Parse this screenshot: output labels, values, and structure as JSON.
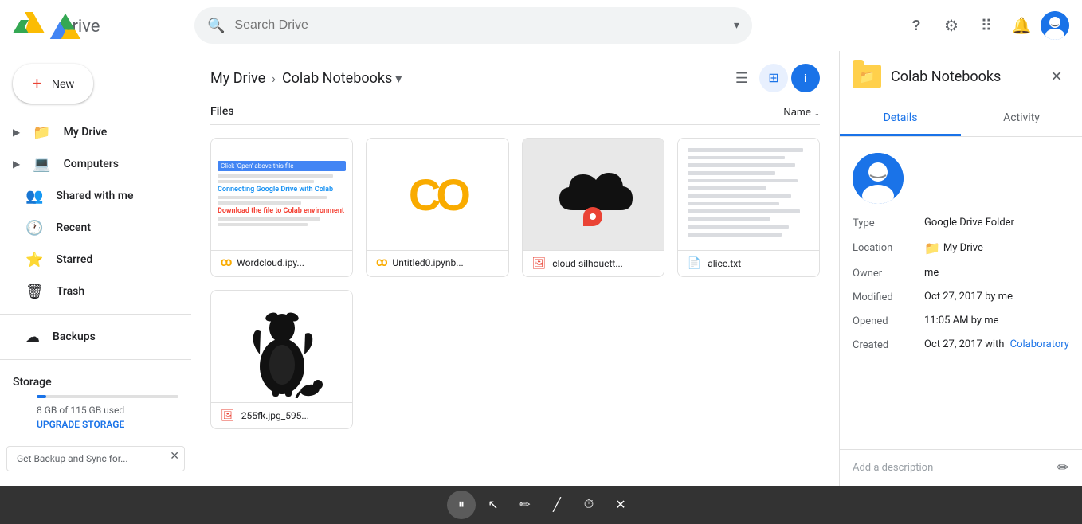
{
  "app": {
    "name": "Drive",
    "logo_alt": "Google Drive"
  },
  "topbar": {
    "search_placeholder": "Search Drive",
    "help_icon": "?",
    "settings_icon": "⚙",
    "apps_icon": "⠿",
    "notifications_icon": "🔔"
  },
  "sidebar": {
    "new_label": "New",
    "items": [
      {
        "id": "my-drive",
        "label": "My Drive",
        "icon": "📁",
        "expandable": true
      },
      {
        "id": "computers",
        "label": "Computers",
        "icon": "💻",
        "expandable": true
      },
      {
        "id": "shared",
        "label": "Shared with me",
        "icon": "👥"
      },
      {
        "id": "recent",
        "label": "Recent",
        "icon": "🕐"
      },
      {
        "id": "starred",
        "label": "Starred",
        "icon": "⭐"
      },
      {
        "id": "trash",
        "label": "Trash",
        "icon": "🗑"
      }
    ],
    "backups_label": "Backups",
    "storage_label": "Storage",
    "storage_used": "8 GB of 115 GB used",
    "upgrade_label": "UPGRADE STORAGE",
    "storage_percent": 7
  },
  "breadcrumb": {
    "root": "My Drive",
    "current": "Colab Notebooks"
  },
  "files": {
    "section_label": "Files",
    "sort_label": "Name",
    "items": [
      {
        "id": "wordcloud",
        "name": "Wordcloud.ipy...",
        "type": "colab",
        "type_icon": "CO",
        "thumb_type": "wordcloud"
      },
      {
        "id": "untitled",
        "name": "Untitled0.ipynb...",
        "type": "colab",
        "type_icon": "CO",
        "thumb_type": "colab"
      },
      {
        "id": "cloud",
        "name": "cloud-silhouett...",
        "type": "image",
        "type_icon": "🖼",
        "thumb_type": "cloud"
      },
      {
        "id": "alice-txt",
        "name": "alice.txt",
        "type": "doc",
        "type_icon": "📄",
        "thumb_type": "text"
      },
      {
        "id": "alice-jpg",
        "name": "255fk.jpg_595...",
        "type": "image",
        "type_icon": "🖼",
        "thumb_type": "alice"
      }
    ]
  },
  "panel": {
    "title": "Colab Notebooks",
    "folder_color": "#ffd04b",
    "tab_details": "Details",
    "tab_activity": "Activity",
    "details": {
      "type_label": "Type",
      "type_value": "Google Drive Folder",
      "location_label": "Location",
      "location_value": "My Drive",
      "owner_label": "Owner",
      "owner_value": "me",
      "modified_label": "Modified",
      "modified_value": "Oct 27, 2017 by me",
      "opened_label": "Opened",
      "opened_value": "11:05 AM by me",
      "created_label": "Created",
      "created_value": "Oct 27, 2017 with",
      "created_link": "Colaboratory"
    },
    "description_placeholder": "Add a description",
    "edit_icon": "✏"
  },
  "toolbar": {
    "buttons": [
      {
        "id": "pause",
        "icon": "⏸",
        "label": "pause"
      },
      {
        "id": "cursor",
        "icon": "↖",
        "label": "cursor"
      },
      {
        "id": "pen",
        "icon": "✏",
        "label": "pen"
      },
      {
        "id": "line",
        "icon": "╱",
        "label": "line"
      },
      {
        "id": "timer",
        "icon": "⏱",
        "label": "timer"
      },
      {
        "id": "close",
        "icon": "✕",
        "label": "close"
      }
    ]
  },
  "notification": {
    "text": "Get Backup and Sync for...",
    "close_icon": "✕"
  }
}
